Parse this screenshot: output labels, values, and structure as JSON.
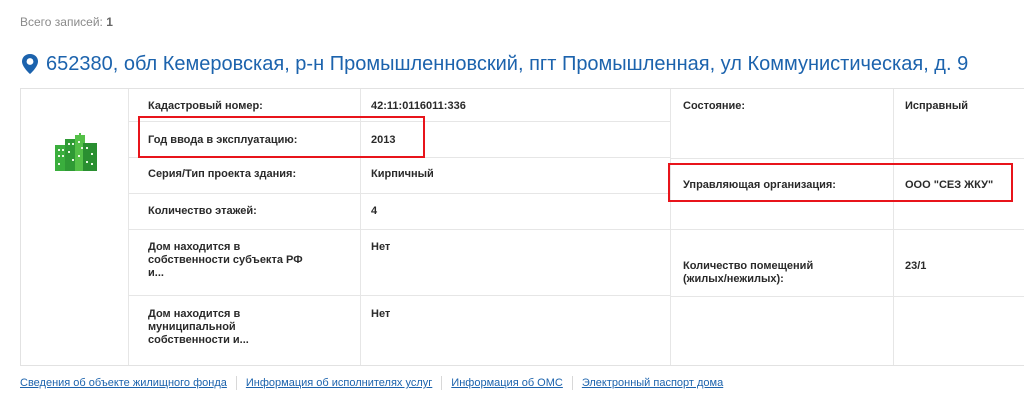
{
  "header": {
    "total_label": "Всего записей:",
    "total_count": "1",
    "address": "652380, обл Кемеровская, р-н Промышленновский, пгт Промышленная, ул Коммунистическая, д. 9",
    "pin_icon": "location-pin-icon"
  },
  "card": {
    "building_icon": "building-icon",
    "left": [
      {
        "label": "Кадастровый номер:",
        "value": "42:11:0116011:336"
      },
      {
        "label": "Год ввода в эксплуатацию:",
        "value": "2013"
      },
      {
        "label": "Серия/Тип проекта здания:",
        "value": "Кирпичный"
      },
      {
        "label": "Количество этажей:",
        "value": "4"
      },
      {
        "label": "Дом находится в собственности субъекта РФ и...",
        "value": "Нет"
      },
      {
        "label": "Дом находится в муниципальной собственности и...",
        "value": "Нет"
      }
    ],
    "right": [
      {
        "label": "Состояние:",
        "value": "Исправный"
      },
      {
        "label": "Управляющая организация:",
        "value": "ООО \"СЕЗ ЖКУ\""
      },
      {
        "label": "Количество помещений (жилых/нежилых):",
        "value": "23/1"
      }
    ]
  },
  "links": [
    "Сведения об объекте жилищного фонда",
    "Информация об исполнителях услуг",
    "Информация об ОМС",
    "Электронный паспорт дома"
  ],
  "colors": {
    "accent": "#1c63ad",
    "highlight": "#e8141b",
    "icon_green": "#2db34a"
  }
}
